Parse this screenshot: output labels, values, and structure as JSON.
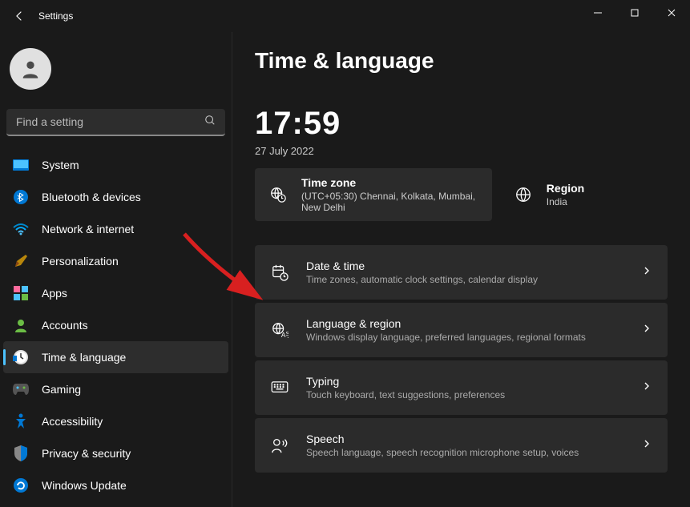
{
  "title": "Settings",
  "search": {
    "placeholder": "Find a setting"
  },
  "sidebar": {
    "items": [
      {
        "label": "System",
        "icon": "system"
      },
      {
        "label": "Bluetooth & devices",
        "icon": "bluetooth"
      },
      {
        "label": "Network & internet",
        "icon": "wifi"
      },
      {
        "label": "Personalization",
        "icon": "brush"
      },
      {
        "label": "Apps",
        "icon": "apps"
      },
      {
        "label": "Accounts",
        "icon": "person"
      },
      {
        "label": "Time & language",
        "icon": "clock"
      },
      {
        "label": "Gaming",
        "icon": "gaming"
      },
      {
        "label": "Accessibility",
        "icon": "accessibility"
      },
      {
        "label": "Privacy & security",
        "icon": "shield"
      },
      {
        "label": "Windows Update",
        "icon": "update"
      }
    ],
    "activeIndex": 6
  },
  "page": {
    "heading": "Time & language",
    "clock": "17:59",
    "date": "27 July 2022",
    "timezone": {
      "label": "Time zone",
      "value": "(UTC+05:30) Chennai, Kolkata, Mumbai, New Delhi"
    },
    "region": {
      "label": "Region",
      "value": "India"
    },
    "items": [
      {
        "title": "Date & time",
        "desc": "Time zones, automatic clock settings, calendar display",
        "icon": "calendar-clock"
      },
      {
        "title": "Language & region",
        "desc": "Windows display language, preferred languages, regional formats",
        "icon": "globe-text"
      },
      {
        "title": "Typing",
        "desc": "Touch keyboard, text suggestions, preferences",
        "icon": "keyboard"
      },
      {
        "title": "Speech",
        "desc": "Speech language, speech recognition microphone setup, voices",
        "icon": "speech"
      }
    ]
  }
}
